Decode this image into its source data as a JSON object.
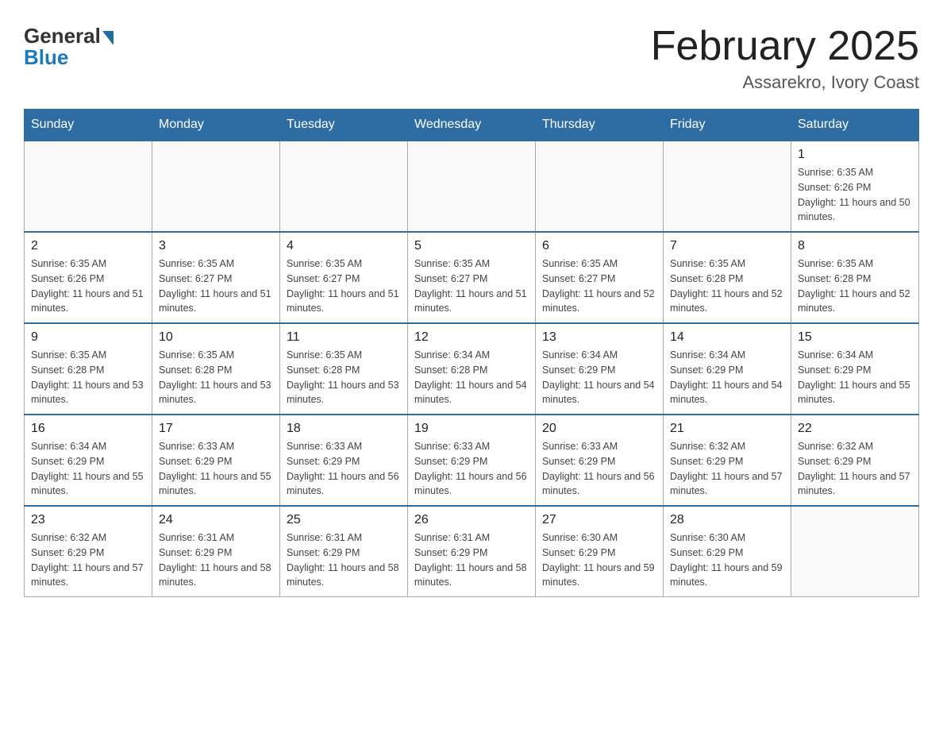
{
  "header": {
    "logo_general": "General",
    "logo_blue": "Blue",
    "month_title": "February 2025",
    "location": "Assarekro, Ivory Coast"
  },
  "days_of_week": [
    "Sunday",
    "Monday",
    "Tuesday",
    "Wednesday",
    "Thursday",
    "Friday",
    "Saturday"
  ],
  "weeks": [
    [
      {
        "day": "",
        "info": ""
      },
      {
        "day": "",
        "info": ""
      },
      {
        "day": "",
        "info": ""
      },
      {
        "day": "",
        "info": ""
      },
      {
        "day": "",
        "info": ""
      },
      {
        "day": "",
        "info": ""
      },
      {
        "day": "1",
        "info": "Sunrise: 6:35 AM\nSunset: 6:26 PM\nDaylight: 11 hours and 50 minutes."
      }
    ],
    [
      {
        "day": "2",
        "info": "Sunrise: 6:35 AM\nSunset: 6:26 PM\nDaylight: 11 hours and 51 minutes."
      },
      {
        "day": "3",
        "info": "Sunrise: 6:35 AM\nSunset: 6:27 PM\nDaylight: 11 hours and 51 minutes."
      },
      {
        "day": "4",
        "info": "Sunrise: 6:35 AM\nSunset: 6:27 PM\nDaylight: 11 hours and 51 minutes."
      },
      {
        "day": "5",
        "info": "Sunrise: 6:35 AM\nSunset: 6:27 PM\nDaylight: 11 hours and 51 minutes."
      },
      {
        "day": "6",
        "info": "Sunrise: 6:35 AM\nSunset: 6:27 PM\nDaylight: 11 hours and 52 minutes."
      },
      {
        "day": "7",
        "info": "Sunrise: 6:35 AM\nSunset: 6:28 PM\nDaylight: 11 hours and 52 minutes."
      },
      {
        "day": "8",
        "info": "Sunrise: 6:35 AM\nSunset: 6:28 PM\nDaylight: 11 hours and 52 minutes."
      }
    ],
    [
      {
        "day": "9",
        "info": "Sunrise: 6:35 AM\nSunset: 6:28 PM\nDaylight: 11 hours and 53 minutes."
      },
      {
        "day": "10",
        "info": "Sunrise: 6:35 AM\nSunset: 6:28 PM\nDaylight: 11 hours and 53 minutes."
      },
      {
        "day": "11",
        "info": "Sunrise: 6:35 AM\nSunset: 6:28 PM\nDaylight: 11 hours and 53 minutes."
      },
      {
        "day": "12",
        "info": "Sunrise: 6:34 AM\nSunset: 6:28 PM\nDaylight: 11 hours and 54 minutes."
      },
      {
        "day": "13",
        "info": "Sunrise: 6:34 AM\nSunset: 6:29 PM\nDaylight: 11 hours and 54 minutes."
      },
      {
        "day": "14",
        "info": "Sunrise: 6:34 AM\nSunset: 6:29 PM\nDaylight: 11 hours and 54 minutes."
      },
      {
        "day": "15",
        "info": "Sunrise: 6:34 AM\nSunset: 6:29 PM\nDaylight: 11 hours and 55 minutes."
      }
    ],
    [
      {
        "day": "16",
        "info": "Sunrise: 6:34 AM\nSunset: 6:29 PM\nDaylight: 11 hours and 55 minutes."
      },
      {
        "day": "17",
        "info": "Sunrise: 6:33 AM\nSunset: 6:29 PM\nDaylight: 11 hours and 55 minutes."
      },
      {
        "day": "18",
        "info": "Sunrise: 6:33 AM\nSunset: 6:29 PM\nDaylight: 11 hours and 56 minutes."
      },
      {
        "day": "19",
        "info": "Sunrise: 6:33 AM\nSunset: 6:29 PM\nDaylight: 11 hours and 56 minutes."
      },
      {
        "day": "20",
        "info": "Sunrise: 6:33 AM\nSunset: 6:29 PM\nDaylight: 11 hours and 56 minutes."
      },
      {
        "day": "21",
        "info": "Sunrise: 6:32 AM\nSunset: 6:29 PM\nDaylight: 11 hours and 57 minutes."
      },
      {
        "day": "22",
        "info": "Sunrise: 6:32 AM\nSunset: 6:29 PM\nDaylight: 11 hours and 57 minutes."
      }
    ],
    [
      {
        "day": "23",
        "info": "Sunrise: 6:32 AM\nSunset: 6:29 PM\nDaylight: 11 hours and 57 minutes."
      },
      {
        "day": "24",
        "info": "Sunrise: 6:31 AM\nSunset: 6:29 PM\nDaylight: 11 hours and 58 minutes."
      },
      {
        "day": "25",
        "info": "Sunrise: 6:31 AM\nSunset: 6:29 PM\nDaylight: 11 hours and 58 minutes."
      },
      {
        "day": "26",
        "info": "Sunrise: 6:31 AM\nSunset: 6:29 PM\nDaylight: 11 hours and 58 minutes."
      },
      {
        "day": "27",
        "info": "Sunrise: 6:30 AM\nSunset: 6:29 PM\nDaylight: 11 hours and 59 minutes."
      },
      {
        "day": "28",
        "info": "Sunrise: 6:30 AM\nSunset: 6:29 PM\nDaylight: 11 hours and 59 minutes."
      },
      {
        "day": "",
        "info": ""
      }
    ]
  ]
}
